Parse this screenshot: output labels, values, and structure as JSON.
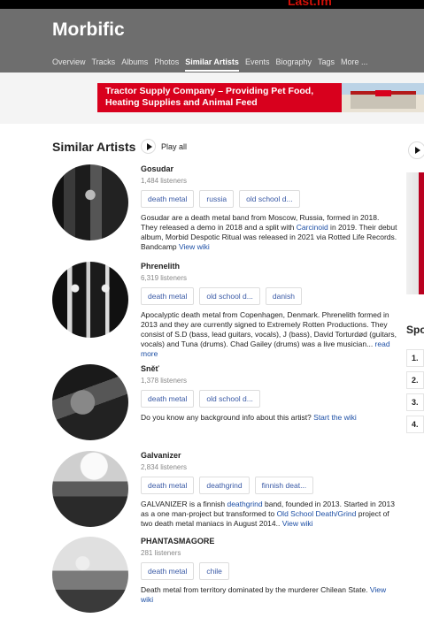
{
  "site": {
    "brand": "Last.fm"
  },
  "artist": {
    "name": "Morbific"
  },
  "nav": {
    "items": [
      {
        "label": "Overview",
        "active": false
      },
      {
        "label": "Tracks",
        "active": false
      },
      {
        "label": "Albums",
        "active": false
      },
      {
        "label": "Photos",
        "active": false
      },
      {
        "label": "Similar Artists",
        "active": true
      },
      {
        "label": "Events",
        "active": false
      },
      {
        "label": "Biography",
        "active": false
      },
      {
        "label": "Tags",
        "active": false
      },
      {
        "label": "More ...",
        "active": false
      }
    ]
  },
  "ad": {
    "text": "Tractor Supply Company – Providing Pet Food, Heating Supplies and Animal Feed",
    "color": "#d8001d"
  },
  "section": {
    "title": "Similar Artists",
    "play_all": "Play all"
  },
  "similar": [
    {
      "name": "Gosudar",
      "listeners": "1,484 listeners",
      "tags": [
        "death metal",
        "russia",
        "old school d..."
      ],
      "bio_parts": [
        "Gosudar are a death metal band from Moscow, Russia, formed in 2018. They released a demo in 2018 and a split with ",
        "Carcinoid",
        " in 2019. Their debut album, Morbid Despotic Ritual was released in 2021 via Rotted Life Records. Bandcamp ",
        "View wiki"
      ]
    },
    {
      "name": "Phrenelith",
      "listeners": "6,319 listeners",
      "tags": [
        "death metal",
        "old school d...",
        "danish"
      ],
      "bio_parts": [
        "Apocalyptic death metal from Copenhagen, Denmark. Phrenelith formed in 2013 and they are currently signed to Extremely Rotten Productions. They consist of S.D (bass, lead guitars, vocals), J (bass), David Torturdød (guitars, vocals) and Tuna (drums). Chad Gailey (drums) was a live musician... ",
        "read more"
      ]
    },
    {
      "name": "Sněť",
      "listeners": "1,378 listeners",
      "tags": [
        "death metal",
        "old school d..."
      ],
      "bio_parts": [
        "Do you know any background info about this artist? ",
        "Start the wiki"
      ]
    },
    {
      "name": "Galvanizer",
      "listeners": "2,834 listeners",
      "tags": [
        "death metal",
        "deathgrind",
        "finnish deat..."
      ],
      "bio_parts": [
        "GALVANIZER is a finnish ",
        "deathgrind",
        " band, founded in 2013. Started in 2013 as a one man-project but transformed to ",
        "Old School Death/Grind",
        " project of two death metal maniacs in August 2014.. ",
        "View wiki"
      ]
    },
    {
      "name": "PHANTASMAGORE",
      "listeners": "281 listeners",
      "tags": [
        "death metal",
        "chile"
      ],
      "bio_parts": [
        "Death metal from territory dominated by the murderer Chilean State. ",
        "View wiki"
      ]
    }
  ],
  "sidebar": {
    "heading": "Spo",
    "ranks": [
      "1.",
      "2.",
      "3.",
      "4."
    ]
  }
}
